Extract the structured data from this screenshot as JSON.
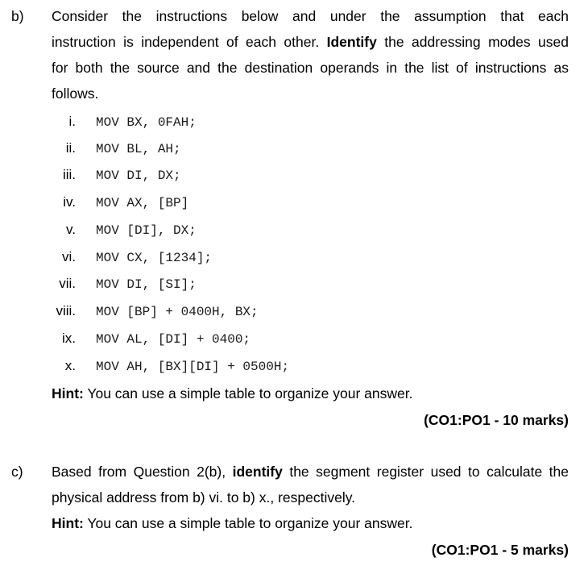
{
  "part_b": {
    "label": "b)",
    "intro_lines": [
      "Consider the instructions below and under the assumption that each",
      {
        "pre": "instruction is independent of each other. ",
        "bold": "Identify",
        "post": " the addressing modes used"
      },
      "for both the source and the destination operands in the list of instructions as",
      "follows."
    ],
    "instructions": [
      {
        "num": "i.",
        "code": "MOV BX, 0FAH;"
      },
      {
        "num": "ii.",
        "code": "MOV BL, AH;"
      },
      {
        "num": "iii.",
        "code": "MOV DI, DX;"
      },
      {
        "num": "iv.",
        "code": "MOV AX, [BP]"
      },
      {
        "num": "v.",
        "code": "MOV [DI], DX;"
      },
      {
        "num": "vi.",
        "code": "MOV CX, [1234];"
      },
      {
        "num": "vii.",
        "code": "MOV DI, [SI];"
      },
      {
        "num": "viii.",
        "code": "MOV [BP] + 0400H, BX;"
      },
      {
        "num": "ix.",
        "code": "MOV AL, [DI] + 0400;"
      },
      {
        "num": "x.",
        "code": "MOV AH, [BX][DI] + 0500H;"
      }
    ],
    "hint_label": "Hint:",
    "hint_text": " You can use a simple table to organize your answer.",
    "marks": "(CO1:PO1 - 10 marks)"
  },
  "part_c": {
    "label": "c)",
    "line1_pre": "Based from Question 2(b), ",
    "line1_bold": "identify",
    "line1_post": " the segment register used to calculate the",
    "line2": "physical address from b) vi. to b) x., respectively.",
    "hint_label": "Hint:",
    "hint_text": " You can use a simple table to organize your answer.",
    "marks": "(CO1:PO1 - 5 marks)"
  }
}
